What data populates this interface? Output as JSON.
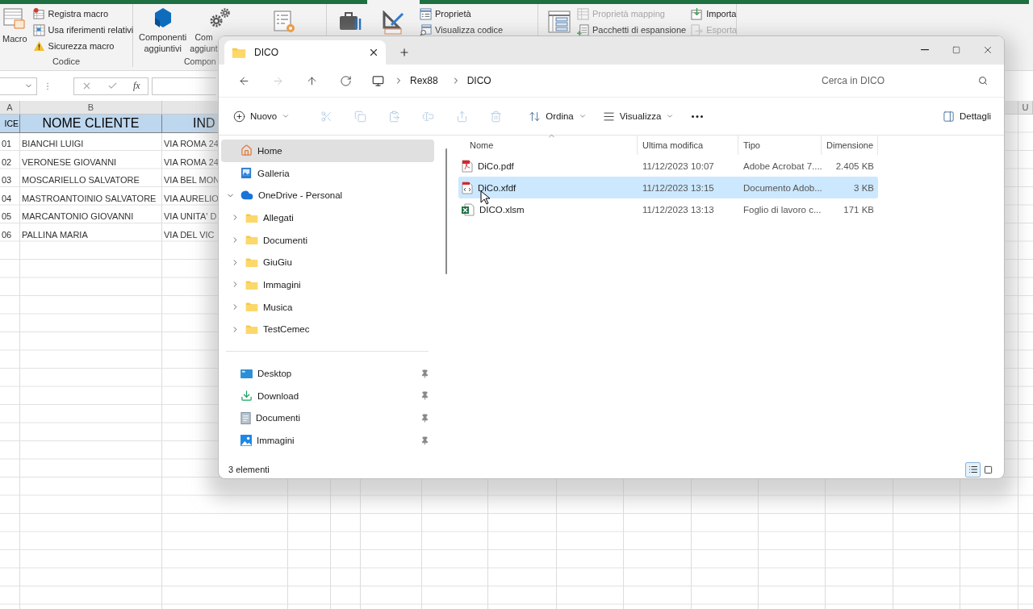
{
  "excel": {
    "ribbon": {
      "macro": {
        "label": "Macro"
      },
      "code_commands": [
        {
          "label": "Registra macro",
          "disabled": false
        },
        {
          "label": "Usa riferimenti relativi",
          "disabled": false
        },
        {
          "label": "Sicurezza macro",
          "disabled": false
        }
      ],
      "code_group": "Codice",
      "addins": [
        {
          "lines": [
            "Componenti",
            "aggiuntivi"
          ]
        },
        {
          "lines": [
            "Com",
            "aggiunt"
          ]
        }
      ],
      "addins_group": "Compon",
      "xml_commands": [
        {
          "label": "Proprietà",
          "disabled": false
        },
        {
          "label": "Visualizza codice",
          "disabled": false
        }
      ],
      "mapping_commands": [
        {
          "label": "Proprietà mapping",
          "disabled": true
        },
        {
          "label": "Pacchetti di espansione",
          "disabled": false
        }
      ],
      "transfer_commands": [
        {
          "label": "Importa",
          "disabled": false
        },
        {
          "label": "Esporta",
          "disabled": true
        }
      ]
    },
    "formula_bar": {
      "function_label": "fx"
    },
    "columns": [
      "A",
      "B"
    ],
    "last_column": "U",
    "header": [
      "ICE",
      "NOME CLIENTE",
      "IND"
    ],
    "rows": [
      [
        "01",
        "BIANCHI LUIGI",
        "VIA ROMA 24"
      ],
      [
        "02",
        "VERONESE GIOVANNI",
        "VIA ROMA 24"
      ],
      [
        "03",
        "MOSCARIELLO SALVATORE",
        "VIA BEL MON"
      ],
      [
        "04",
        "MASTROANTOINIO SALVATORE",
        "VIA AURELIO"
      ],
      [
        "05",
        "MARCANTONIO GIOVANNI",
        "VIA UNITA' D"
      ],
      [
        "06",
        "PALLINA MARIA",
        "VIA DEL VIC"
      ]
    ]
  },
  "explorer": {
    "tab": {
      "title": "DICO",
      "selected": true
    },
    "navigation": [
      {
        "disabled": false
      },
      {
        "disabled": true
      },
      {
        "disabled": false
      },
      {
        "disabled": false
      }
    ],
    "breadcrumb": [
      "Rex88",
      "DICO"
    ],
    "search": {
      "placeholder": "Cerca in DICO"
    },
    "commands": {
      "new": "Nuovo",
      "sort": "Ordina",
      "view": "Visualizza",
      "details": "Dettagli"
    },
    "edit_actions": [
      {
        "disabled": true
      },
      {
        "disabled": true
      },
      {
        "disabled": true
      },
      {
        "disabled": true
      },
      {
        "disabled": true
      },
      {
        "disabled": true
      }
    ],
    "sidebar": {
      "items": [
        {
          "kind": "home",
          "label": "Home",
          "selected": true
        },
        {
          "kind": "gallery",
          "label": "Galleria",
          "selected": false
        },
        {
          "kind": "cloud",
          "label": "OneDrive - Personal",
          "selected": false,
          "expanded": true,
          "children": [
            {
              "kind": "folder",
              "label": "Allegati",
              "selected": false,
              "expanded": false
            },
            {
              "kind": "folder",
              "label": "Documenti",
              "selected": false,
              "expanded": false
            },
            {
              "kind": "folder",
              "label": "GiuGiu",
              "selected": false,
              "expanded": false
            },
            {
              "kind": "folder",
              "label": "Immagini",
              "selected": false,
              "expanded": false
            },
            {
              "kind": "folder",
              "label": "Musica",
              "selected": false,
              "expanded": false
            },
            {
              "kind": "folder",
              "label": "TestCemec",
              "selected": false,
              "expanded": false
            }
          ]
        }
      ],
      "quick_access": [
        {
          "kind": "desktop",
          "label": "Desktop",
          "pinned": true
        },
        {
          "kind": "download",
          "label": "Download",
          "pinned": true
        },
        {
          "kind": "documents",
          "label": "Documenti",
          "pinned": true
        },
        {
          "kind": "pictures",
          "label": "Immagini",
          "pinned": true
        }
      ]
    },
    "files": {
      "columns": [
        "Nome",
        "Ultima modifica",
        "Tipo",
        "Dimensione"
      ],
      "rows": [
        {
          "kind": "pdf",
          "name": "DiCo.pdf",
          "modified": "11/12/2023 10:07",
          "type": "Adobe Acrobat 7....",
          "size": "2.405 KB",
          "selected": false
        },
        {
          "kind": "xfdf",
          "name": "DiCo.xfdf",
          "modified": "11/12/2023 13:15",
          "type": "Documento Adob...",
          "size": "3 KB",
          "selected": true
        },
        {
          "kind": "xlsm",
          "name": "DICO.xlsm",
          "modified": "11/12/2023 13:13",
          "type": "Foglio di lavoro c...",
          "size": "171 KB",
          "selected": false
        }
      ]
    },
    "status": "3 elementi",
    "view_modes": [
      {
        "selected": true
      },
      {
        "selected": false
      }
    ]
  }
}
